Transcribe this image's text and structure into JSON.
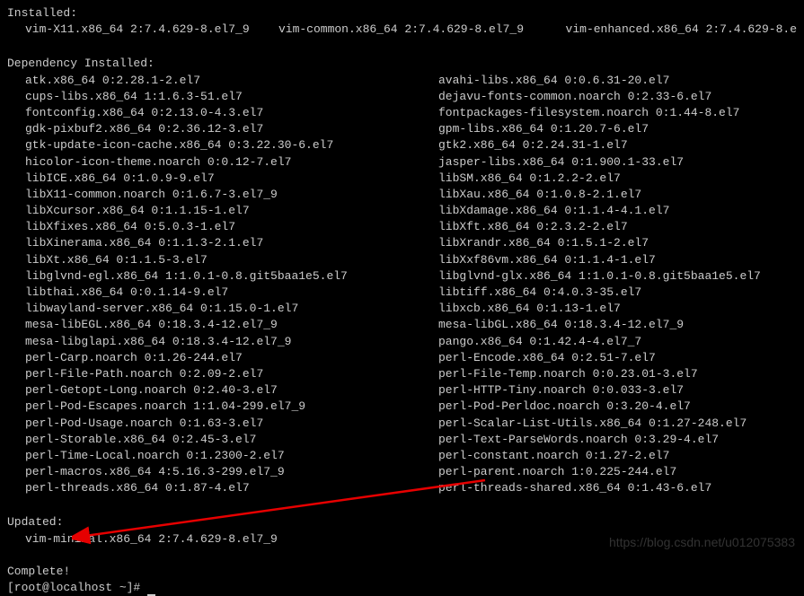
{
  "sections": {
    "installed_header": "Installed:",
    "installed_items": [
      "vim-X11.x86_64 2:7.4.629-8.el7_9",
      "vim-common.x86_64 2:7.4.629-8.el7_9",
      "vim-enhanced.x86_64 2:7.4.629-8.e"
    ],
    "dep_installed_header": "Dependency Installed:",
    "dep_installed_left": [
      "atk.x86_64 0:2.28.1-2.el7",
      "cups-libs.x86_64 1:1.6.3-51.el7",
      "fontconfig.x86_64 0:2.13.0-4.3.el7",
      "gdk-pixbuf2.x86_64 0:2.36.12-3.el7",
      "gtk-update-icon-cache.x86_64 0:3.22.30-6.el7",
      "hicolor-icon-theme.noarch 0:0.12-7.el7",
      "libICE.x86_64 0:1.0.9-9.el7",
      "libX11-common.noarch 0:1.6.7-3.el7_9",
      "libXcursor.x86_64 0:1.1.15-1.el7",
      "libXfixes.x86_64 0:5.0.3-1.el7",
      "libXinerama.x86_64 0:1.1.3-2.1.el7",
      "libXt.x86_64 0:1.1.5-3.el7",
      "libglvnd-egl.x86_64 1:1.0.1-0.8.git5baa1e5.el7",
      "libthai.x86_64 0:0.1.14-9.el7",
      "libwayland-server.x86_64 0:1.15.0-1.el7",
      "mesa-libEGL.x86_64 0:18.3.4-12.el7_9",
      "mesa-libglapi.x86_64 0:18.3.4-12.el7_9",
      "perl-Carp.noarch 0:1.26-244.el7",
      "perl-File-Path.noarch 0:2.09-2.el7",
      "perl-Getopt-Long.noarch 0:2.40-3.el7",
      "perl-Pod-Escapes.noarch 1:1.04-299.el7_9",
      "perl-Pod-Usage.noarch 0:1.63-3.el7",
      "perl-Storable.x86_64 0:2.45-3.el7",
      "perl-Time-Local.noarch 0:1.2300-2.el7",
      "perl-macros.x86_64 4:5.16.3-299.el7_9",
      "perl-threads.x86_64 0:1.87-4.el7"
    ],
    "dep_installed_right": [
      "avahi-libs.x86_64 0:0.6.31-20.el7",
      "dejavu-fonts-common.noarch 0:2.33-6.el7",
      "fontpackages-filesystem.noarch 0:1.44-8.el7",
      "gpm-libs.x86_64 0:1.20.7-6.el7",
      "gtk2.x86_64 0:2.24.31-1.el7",
      "jasper-libs.x86_64 0:1.900.1-33.el7",
      "libSM.x86_64 0:1.2.2-2.el7",
      "libXau.x86_64 0:1.0.8-2.1.el7",
      "libXdamage.x86_64 0:1.1.4-4.1.el7",
      "libXft.x86_64 0:2.3.2-2.el7",
      "libXrandr.x86_64 0:1.5.1-2.el7",
      "libXxf86vm.x86_64 0:1.1.4-1.el7",
      "libglvnd-glx.x86_64 1:1.0.1-0.8.git5baa1e5.el7",
      "libtiff.x86_64 0:4.0.3-35.el7",
      "libxcb.x86_64 0:1.13-1.el7",
      "mesa-libGL.x86_64 0:18.3.4-12.el7_9",
      "pango.x86_64 0:1.42.4-4.el7_7",
      "perl-Encode.x86_64 0:2.51-7.el7",
      "perl-File-Temp.noarch 0:0.23.01-3.el7",
      "perl-HTTP-Tiny.noarch 0:0.033-3.el7",
      "perl-Pod-Perldoc.noarch 0:3.20-4.el7",
      "perl-Scalar-List-Utils.x86_64 0:1.27-248.el7",
      "perl-Text-ParseWords.noarch 0:3.29-4.el7",
      "perl-constant.noarch 0:1.27-2.el7",
      "perl-parent.noarch 1:0.225-244.el7",
      "perl-threads-shared.x86_64 0:1.43-6.el7"
    ],
    "updated_header": "Updated:",
    "updated_item": "vim-minimal.x86_64 2:7.4.629-8.el7_9",
    "complete": "Complete!",
    "prompt": "[root@localhost ~]# "
  },
  "watermark": "https://blog.csdn.net/u012075383"
}
